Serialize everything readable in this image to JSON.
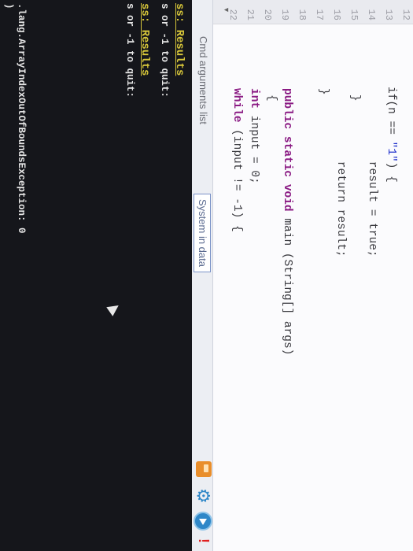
{
  "editor": {
    "line_numbers": [
      "12",
      "13",
      "14",
      "15",
      "16",
      "17",
      "18",
      "19",
      "20",
      "21",
      "22"
    ],
    "lines": [
      {
        "parts": [
          {
            "t": "if(n == "
          },
          {
            "t": "\"1\"",
            "c": "str"
          },
          {
            "t": ") {"
          }
        ]
      },
      {
        "parts": [
          {
            "t": "    result = true;"
          }
        ]
      },
      {
        "parts": [
          {
            "t": "}"
          }
        ]
      },
      {
        "parts": [
          {
            "t": "    return result;"
          }
        ]
      },
      {
        "parts": [
          {
            "t": "}"
          }
        ]
      },
      {
        "parts": [
          {
            "t": ""
          }
        ]
      },
      {
        "parts": [
          {
            "t": "public static void",
            "c": "kw"
          },
          {
            "t": " main (String[] args)"
          }
        ]
      },
      {
        "parts": [
          {
            "t": "{"
          }
        ]
      },
      {
        "parts": [
          {
            "t": "int",
            "c": "kw"
          },
          {
            "t": " input = 0;"
          }
        ]
      },
      {
        "parts": [
          {
            "t": "while",
            "c": "kw"
          },
          {
            "t": " (input != -1) {"
          }
        ]
      }
    ]
  },
  "tabs": {
    "cmd_args": "Cmd arguments list",
    "system_in": "System in data"
  },
  "console": {
    "lines": [
      {
        "text": "ss: Results",
        "kind": "header"
      },
      {
        "text": "s or -1 to quit:",
        "kind": "plain"
      },
      {
        "text": "ss: Results",
        "kind": "header"
      },
      {
        "text": "s or -1 to quit:",
        "kind": "plain"
      },
      {
        "text": ".lang.ArrayIndexOutOfBoundsException: 0",
        "kind": "plain"
      },
      {
        "text": ")",
        "kind": "plain"
      }
    ]
  },
  "icons": [
    "save-icon",
    "settings-gear-icon",
    "run-icon",
    "stop-icon"
  ]
}
